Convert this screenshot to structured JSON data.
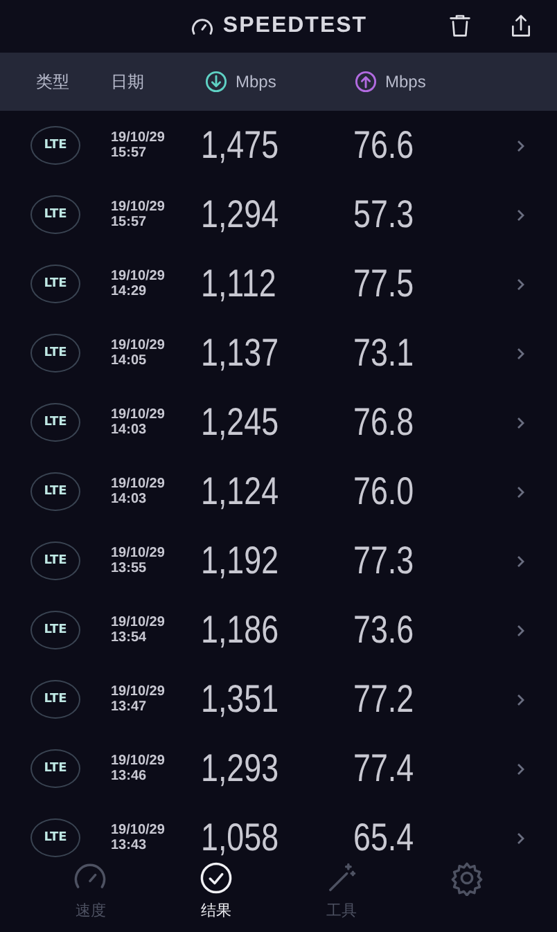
{
  "app_bar": {
    "title": "SPEEDTEST"
  },
  "columns": [
    {
      "kind": "text",
      "label": "类型"
    },
    {
      "kind": "text",
      "label": "日期"
    },
    {
      "kind": "download",
      "label": "Mbps"
    },
    {
      "kind": "upload",
      "label": "Mbps"
    }
  ],
  "results": [
    {
      "type": "LTE",
      "date": "19/10/29",
      "time": "15:57",
      "download": "1,475",
      "upload": "76.6"
    },
    {
      "type": "LTE",
      "date": "19/10/29",
      "time": "15:57",
      "download": "1,294",
      "upload": "57.3"
    },
    {
      "type": "LTE",
      "date": "19/10/29",
      "time": "14:29",
      "download": "1,112",
      "upload": "77.5"
    },
    {
      "type": "LTE",
      "date": "19/10/29",
      "time": "14:05",
      "download": "1,137",
      "upload": "73.1"
    },
    {
      "type": "LTE",
      "date": "19/10/29",
      "time": "14:03",
      "download": "1,245",
      "upload": "76.8"
    },
    {
      "type": "LTE",
      "date": "19/10/29",
      "time": "14:03",
      "download": "1,124",
      "upload": "76.0"
    },
    {
      "type": "LTE",
      "date": "19/10/29",
      "time": "13:55",
      "download": "1,192",
      "upload": "77.3"
    },
    {
      "type": "LTE",
      "date": "19/10/29",
      "time": "13:54",
      "download": "1,186",
      "upload": "73.6"
    },
    {
      "type": "LTE",
      "date": "19/10/29",
      "time": "13:47",
      "download": "1,351",
      "upload": "77.2"
    },
    {
      "type": "LTE",
      "date": "19/10/29",
      "time": "13:46",
      "download": "1,293",
      "upload": "77.4"
    },
    {
      "type": "LTE",
      "date": "19/10/29",
      "time": "13:43",
      "download": "1,058",
      "upload": "65.4"
    }
  ],
  "tab_bar": [
    {
      "kind": "speed",
      "label": "速度",
      "selected": false
    },
    {
      "kind": "results",
      "label": "结果",
      "selected": true
    },
    {
      "kind": "tools",
      "label": "工具",
      "selected": false
    },
    {
      "kind": "settings",
      "selected": false
    }
  ]
}
